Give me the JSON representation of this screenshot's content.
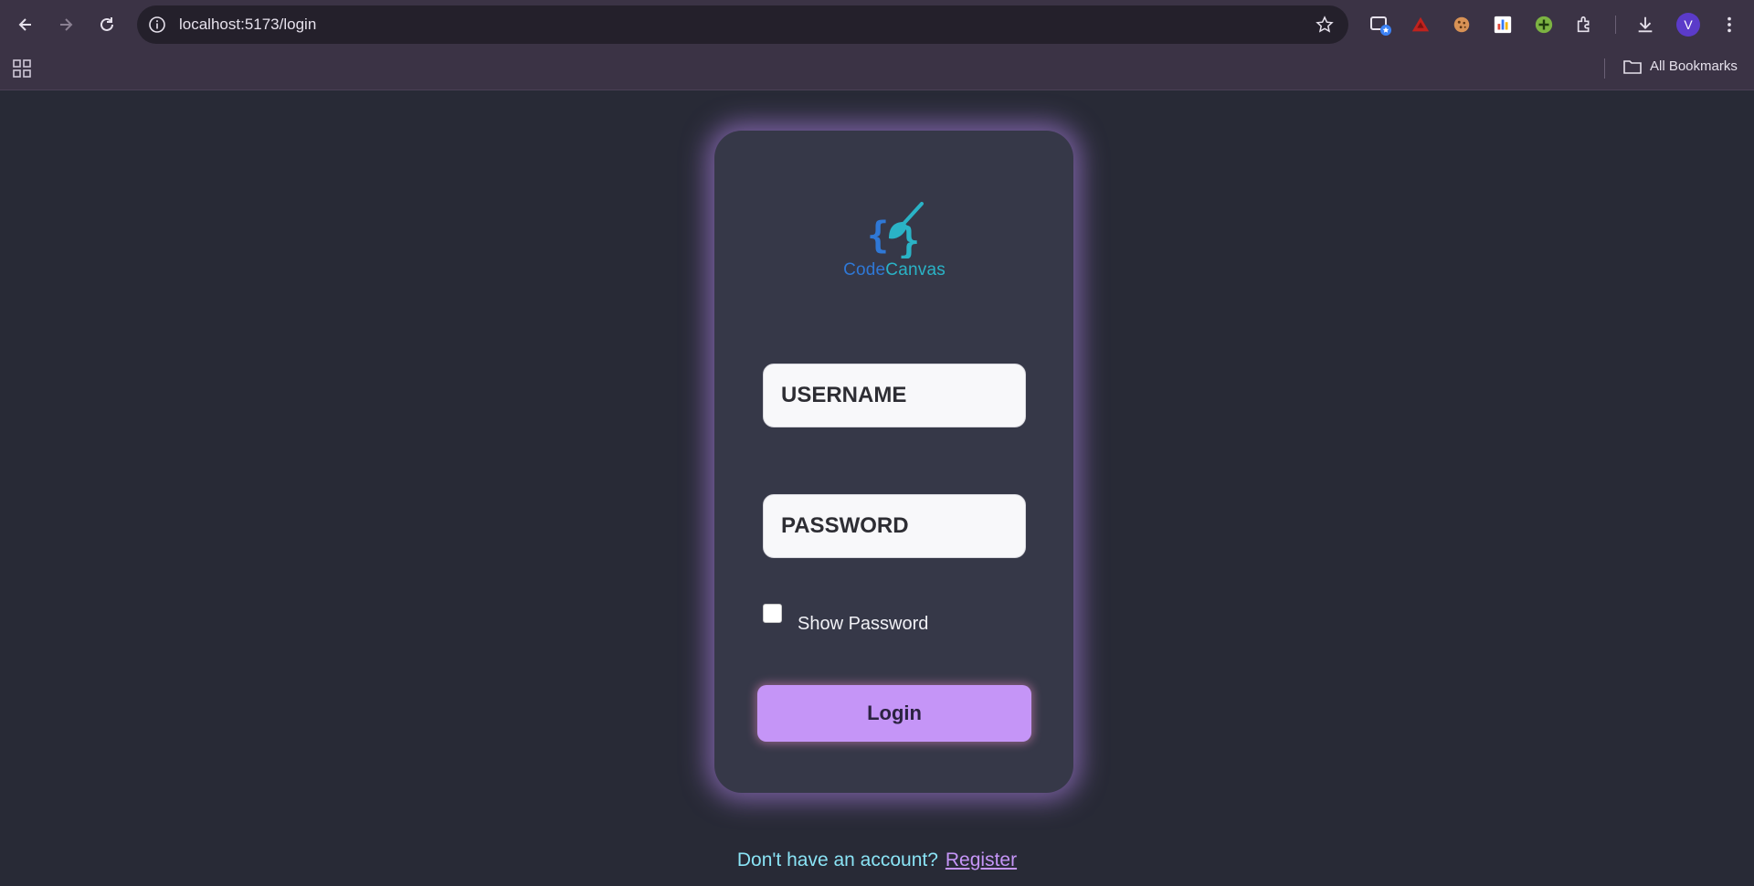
{
  "browser": {
    "url": "localhost:5173/login",
    "bookmarks_label": "All Bookmarks",
    "profile_initial": "V",
    "nav_icons": [
      "back-arrow-icon",
      "forward-arrow-icon",
      "reload-icon"
    ],
    "extensions": [
      "screen-capture-extension-icon",
      "red-triangle-extension-icon",
      "cookie-extension-icon",
      "chart-extension-icon",
      "green-plus-extension-icon",
      "puzzle-extensions-icon"
    ],
    "accent": "#3b3345"
  },
  "brand": {
    "part1": "Code",
    "part2": "Canvas",
    "colors": {
      "part1": "#2f78d6",
      "part2": "#2ab3c6"
    }
  },
  "form": {
    "username_placeholder": "USERNAME",
    "password_placeholder": "PASSWORD",
    "show_password_label": "Show Password",
    "show_password_checked": false,
    "login_label": "Login"
  },
  "footer": {
    "question": "Don't have an account?",
    "register_label": "Register"
  },
  "colors": {
    "background": "#282a36",
    "card": "#363848",
    "button": "#c595f7",
    "glow": "#be8cfa",
    "footer_text": "#8ae3f5"
  }
}
